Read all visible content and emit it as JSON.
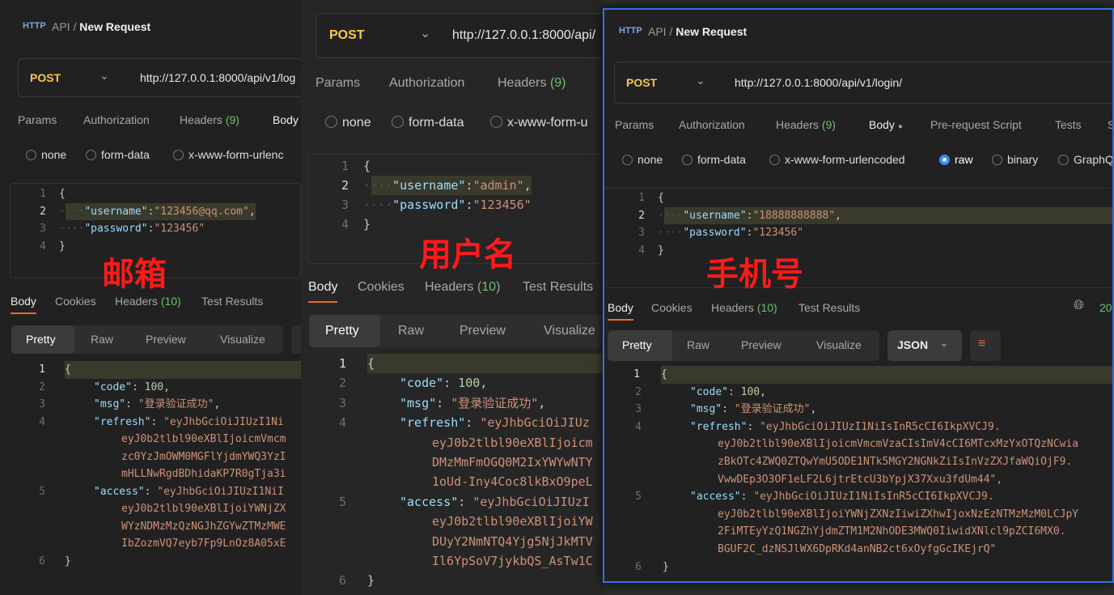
{
  "crumb": {
    "api": "API",
    "sep": "/",
    "title": "New Request"
  },
  "method": "POST",
  "url_short": "http://127.0.0.1:8000/api/v1/log",
  "url_mid": "http://127.0.0.1:8000/api/",
  "url_full": "http://127.0.0.1:8000/api/v1/login/",
  "tabs": {
    "params": "Params",
    "auth": "Authorization",
    "headers": "Headers",
    "headers_count": "(9)",
    "body": "Body",
    "prereq": "Pre-request Script",
    "tests": "Tests"
  },
  "body_types": {
    "none": "none",
    "form": "form-data",
    "urlenc": "x-www-form-urlencoded",
    "urlenc_cut": "x-www-form-urlenc",
    "urlenc_cut2": "x-www-form-u",
    "raw": "raw",
    "binary": "binary",
    "graphql": "GraphQ"
  },
  "resp_tabs": {
    "body": "Body",
    "cookies": "Cookies",
    "headers": "Headers",
    "headers_count": "(10)",
    "tests": "Test Results",
    "status": "20"
  },
  "view_tabs": {
    "pretty": "Pretty",
    "raw": "Raw",
    "preview": "Preview",
    "visualize": "Visualize",
    "json": "JSON"
  },
  "labels": {
    "email": "邮箱",
    "username": "用户名",
    "phone": "手机号"
  },
  "req1": {
    "username": "\"123456@qq.com\"",
    "password": "\"123456\""
  },
  "req2": {
    "username": "\"admin\"",
    "password": "\"123456\""
  },
  "req3": {
    "username": "\"18888888888\"",
    "password": "\"123456\""
  },
  "json": {
    "brace_open": "{",
    "brace_close": "}",
    "k_user": "\"username\"",
    "k_pass": "\"password\"",
    "k_code": "\"code\"",
    "k_msg": "\"msg\"",
    "k_refresh": "\"refresh\"",
    "k_access": "\"access\"",
    "code": "100",
    "msg": "\"登录验证成功\""
  },
  "resp1": {
    "refresh": [
      "\"eyJhbGciOiJIUzI1Ni",
      "eyJ0b2tlbl90eXBlIjoicmVmcm",
      "zc0YzJmOWM0MGFlYjdmYWQ3YzI",
      "mHLLNwRgdBDhidaKP7R0gTja3i"
    ],
    "access": [
      "\"eyJhbGciOiJIUzI1NiI",
      "eyJ0b2tlbl90eXBlIjoiYWNjZX",
      "WYzNDMzMzQzNGJhZGYwZTMzMWE",
      "IbZozmVQ7eyb7Fp9LnOz8A05xE"
    ]
  },
  "resp2": {
    "refresh": [
      "\"eyJhbGciOiJIUz",
      "eyJ0b2tlbl90eXBlIjoicm",
      "DMzMmFmOGQ0M2IxYWYwNTY",
      "1oUd-Iny4Coc8lkBxO9peL"
    ],
    "access": [
      "\"eyJhbGciOiJIUzI",
      "eyJ0b2tlbl90eXBlIjoiYW",
      "DUyY2NmNTQ4Yjg5NjJkMTV",
      "Il6YpSoV7jykbQS_AsTw1C"
    ]
  },
  "resp3": {
    "refresh": [
      "\"eyJhbGciOiJIUzI1NiIsInR5cCI6IkpXVCJ9.",
      "eyJ0b2tlbl90eXBlIjoicmVmcmVzaCIsImV4cCI6MTcxMzYxOTQzNCwia",
      "zBkOTc4ZWQ0ZTQwYmU5ODE1NTk5MGY2NGNkZiIsInVzZXJfaWQiOjF9.",
      "VwwDEp3O3OF1eLF2L6jtrEtcU3bYpjX37Xxu3fdUm44\","
    ],
    "access": [
      "\"eyJhbGciOiJIUzI1NiIsInR5cCI6IkpXVCJ9.",
      "eyJ0b2tlbl90eXBlIjoiYWNjZXNzIiwiZXhwIjoxNzEzNTMzMzM0LCJpY",
      "2FiMTEyYzQ1NGZhYjdmZTM1M2NhODE3MWQ0IiwidXNlcl9pZCI6MX0.",
      "BGUF2C_dzNSJlWX6DpRKd4anNB2ct6xOyfgGcIKEjrQ\""
    ]
  },
  "lines": [
    "1",
    "2",
    "3",
    "4",
    "5",
    "6"
  ]
}
